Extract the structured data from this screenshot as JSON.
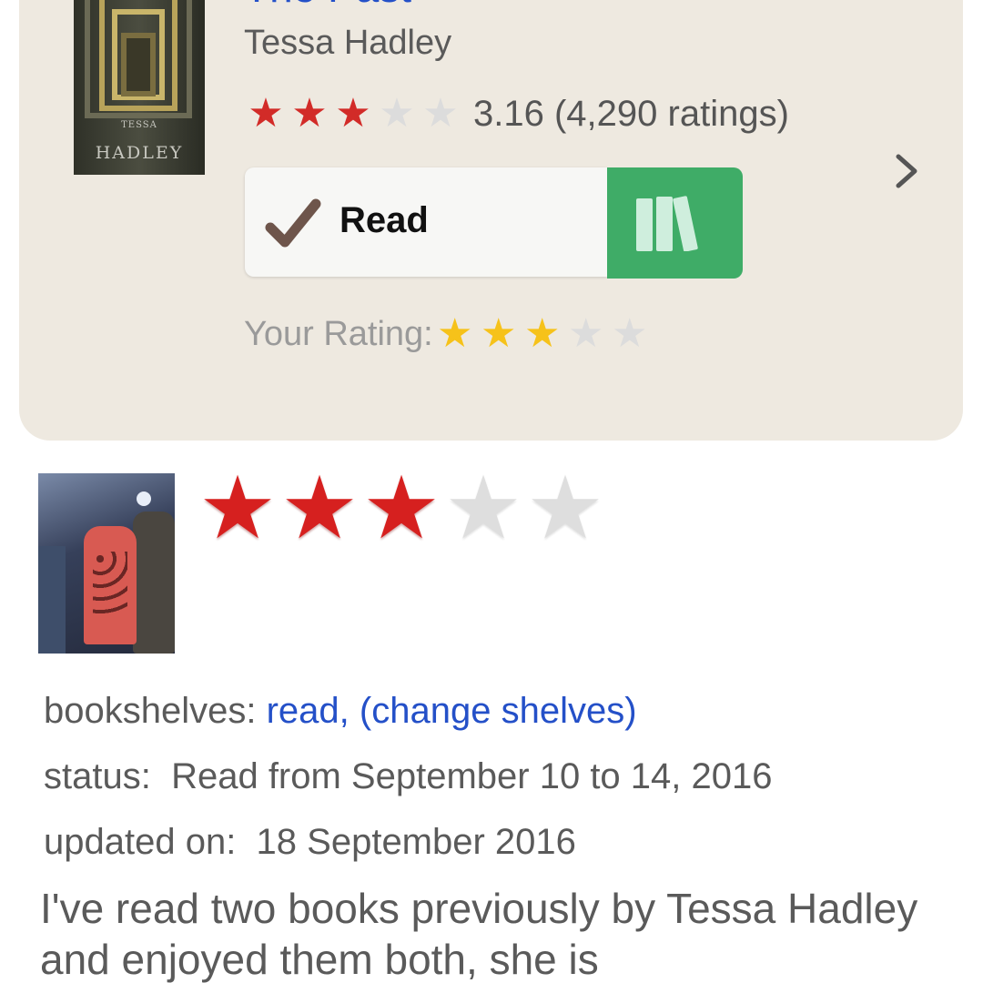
{
  "book": {
    "title": "The Past",
    "author": "Tessa Hadley",
    "average_rating": "3.16",
    "ratings_count": "(4,290 ratings)",
    "average_stars_filled": 3,
    "stars_total": 5,
    "cover": {
      "author_first": "TESSA",
      "author_last": "HADLEY"
    }
  },
  "shelf_button": {
    "label": "Read",
    "status_icon": "checkmark-icon",
    "shelves_icon": "bookshelf-icon",
    "color": "#3fac67"
  },
  "your_rating": {
    "label": "Your Rating:",
    "value": 3,
    "max": 5
  },
  "review": {
    "stars": 3,
    "max_stars": 5,
    "bookshelves_label": "bookshelves:",
    "bookshelves_value": "read,",
    "change_shelves": "(change shelves)",
    "status_label": "status:",
    "status_value": "Read from September 10 to 14, 2016",
    "updated_label": "updated on:",
    "updated_value": "18 September 2016",
    "text": "I've read two books previously by Tessa Hadley and enjoyed them both, she is"
  },
  "colors": {
    "link": "#2450c8",
    "star_red": "#d22b28",
    "star_yellow": "#f6c21a",
    "star_empty": "#dcdcdc",
    "card_bg": "#eee9e0"
  }
}
